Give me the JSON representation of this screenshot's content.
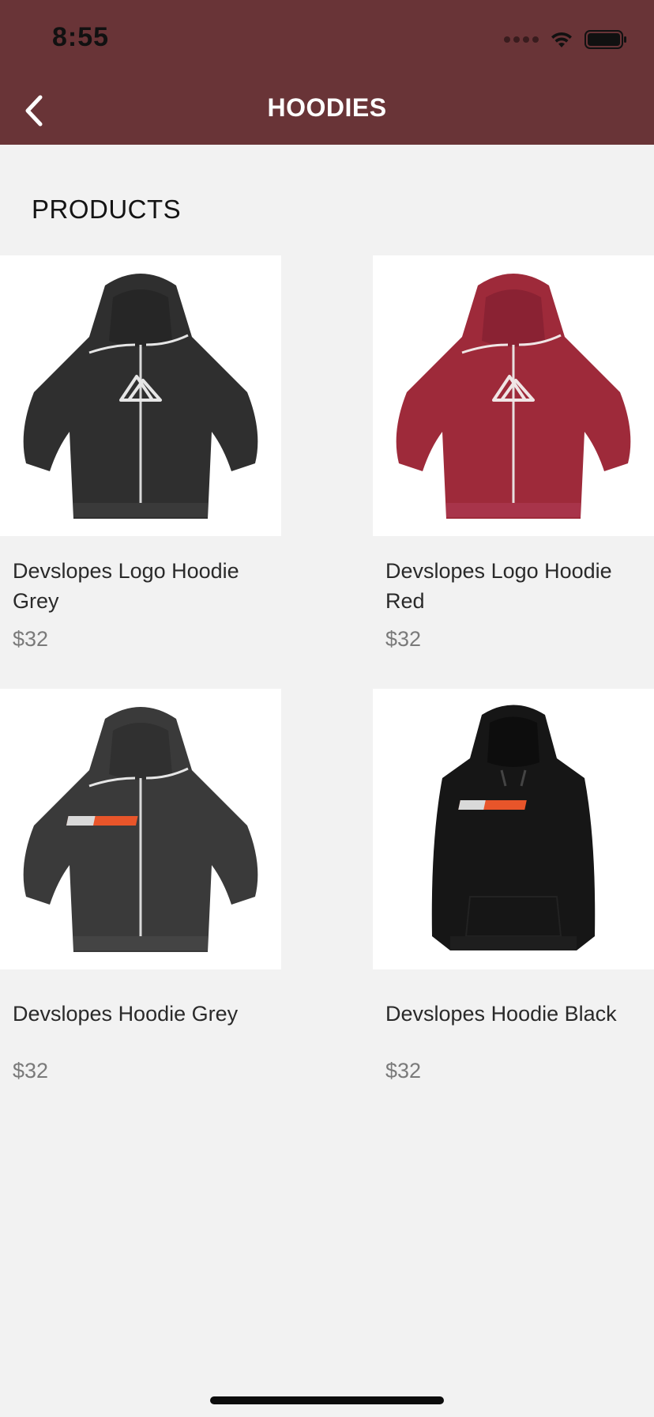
{
  "status_bar": {
    "time": "8:55",
    "icons": [
      "signal-dots-icon",
      "wifi-icon",
      "battery-icon"
    ]
  },
  "nav": {
    "title": "HOODIES",
    "back_icon": "chevron-left-icon"
  },
  "section": {
    "title": "PRODUCTS"
  },
  "products": [
    {
      "name": "Devslopes Logo Hoodie Grey",
      "price": "$32",
      "image": "grey-zip-hoodie-mountain-logo",
      "color": "#2f2f2f"
    },
    {
      "name": "Devslopes Logo Hoodie Red",
      "price": "$32",
      "image": "red-zip-hoodie-mountain-logo",
      "color": "#9e2a3a"
    },
    {
      "name": "Devslopes Hoodie Grey",
      "price": "$32",
      "image": "grey-zip-hoodie-devslopes-text",
      "color": "#3a3a3a"
    },
    {
      "name": "Devslopes Hoodie Black",
      "price": "$32",
      "image": "black-pullover-hoodie-devslopes-text",
      "color": "#161616"
    }
  ],
  "colors": {
    "header_bg": "#693437",
    "page_bg": "#f2f2f2",
    "logo_accent": "#e8552a"
  }
}
